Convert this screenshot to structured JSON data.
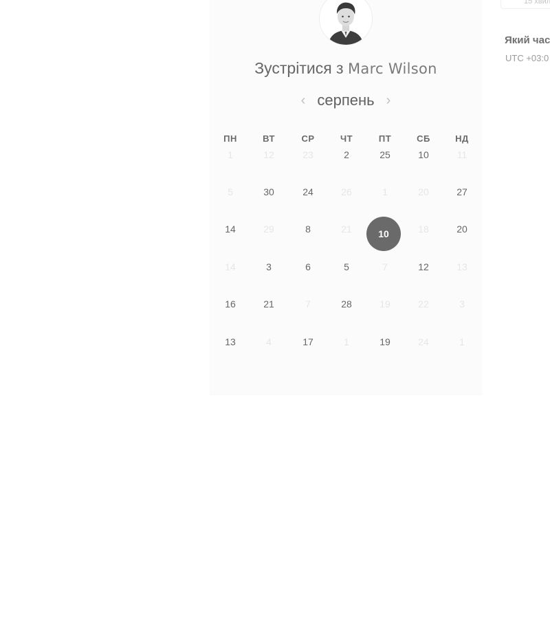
{
  "booking": {
    "title_prefix": "Зустрітися з",
    "host_name": "Marc Wilson",
    "avatar_icon": "person-avatar-icon"
  },
  "calendar": {
    "month": "серпень",
    "prev_icon": "chevron-left-icon",
    "next_icon": "chevron-right-icon",
    "weekdays": [
      "ПН",
      "ВТ",
      "СР",
      "ЧТ",
      "ПТ",
      "СБ",
      "НД"
    ],
    "weeks": [
      [
        {
          "label": "1",
          "state": "unavailable"
        },
        {
          "label": "12",
          "state": "unavailable"
        },
        {
          "label": "23",
          "state": "unavailable"
        },
        {
          "label": "2",
          "state": "available"
        },
        {
          "label": "25",
          "state": "available"
        },
        {
          "label": "10",
          "state": "available"
        },
        {
          "label": "11",
          "state": "unavailable"
        }
      ],
      [
        {
          "label": "5",
          "state": "unavailable"
        },
        {
          "label": "30",
          "state": "available"
        },
        {
          "label": "24",
          "state": "available"
        },
        {
          "label": "26",
          "state": "unavailable"
        },
        {
          "label": "1",
          "state": "unavailable"
        },
        {
          "label": "20",
          "state": "unavailable"
        },
        {
          "label": "27",
          "state": "available"
        }
      ],
      [
        {
          "label": "14",
          "state": "available"
        },
        {
          "label": "29",
          "state": "unavailable"
        },
        {
          "label": "8",
          "state": "available"
        },
        {
          "label": "21",
          "state": "unavailable"
        },
        {
          "label": "10",
          "state": "selected"
        },
        {
          "label": "18",
          "state": "unavailable"
        },
        {
          "label": "20",
          "state": "available"
        }
      ],
      [
        {
          "label": "14",
          "state": "unavailable"
        },
        {
          "label": "3",
          "state": "available"
        },
        {
          "label": "6",
          "state": "available"
        },
        {
          "label": "5",
          "state": "available"
        },
        {
          "label": "7",
          "state": "unavailable"
        },
        {
          "label": "12",
          "state": "available"
        },
        {
          "label": "13",
          "state": "unavailable"
        }
      ],
      [
        {
          "label": "16",
          "state": "available"
        },
        {
          "label": "21",
          "state": "available"
        },
        {
          "label": "7",
          "state": "unavailable"
        },
        {
          "label": "28",
          "state": "available"
        },
        {
          "label": "19",
          "state": "unavailable"
        },
        {
          "label": "22",
          "state": "unavailable"
        },
        {
          "label": "3",
          "state": "unavailable"
        }
      ],
      [
        {
          "label": "13",
          "state": "available"
        },
        {
          "label": "4",
          "state": "unavailable"
        },
        {
          "label": "17",
          "state": "available"
        },
        {
          "label": "1",
          "state": "unavailable"
        },
        {
          "label": "19",
          "state": "available"
        },
        {
          "label": "24",
          "state": "unavailable"
        },
        {
          "label": "1",
          "state": "unavailable"
        }
      ]
    ]
  },
  "side_panel": {
    "duration_text": "15 хвил",
    "timezone_question": "Який час",
    "timezone_value": "UTC +03:0"
  },
  "colors": {
    "card_background": "#fbfbfb",
    "selected_day": "#6a6a6a",
    "available_day_text": "#666666",
    "unavailable_day_text": "#e6e6e6"
  }
}
